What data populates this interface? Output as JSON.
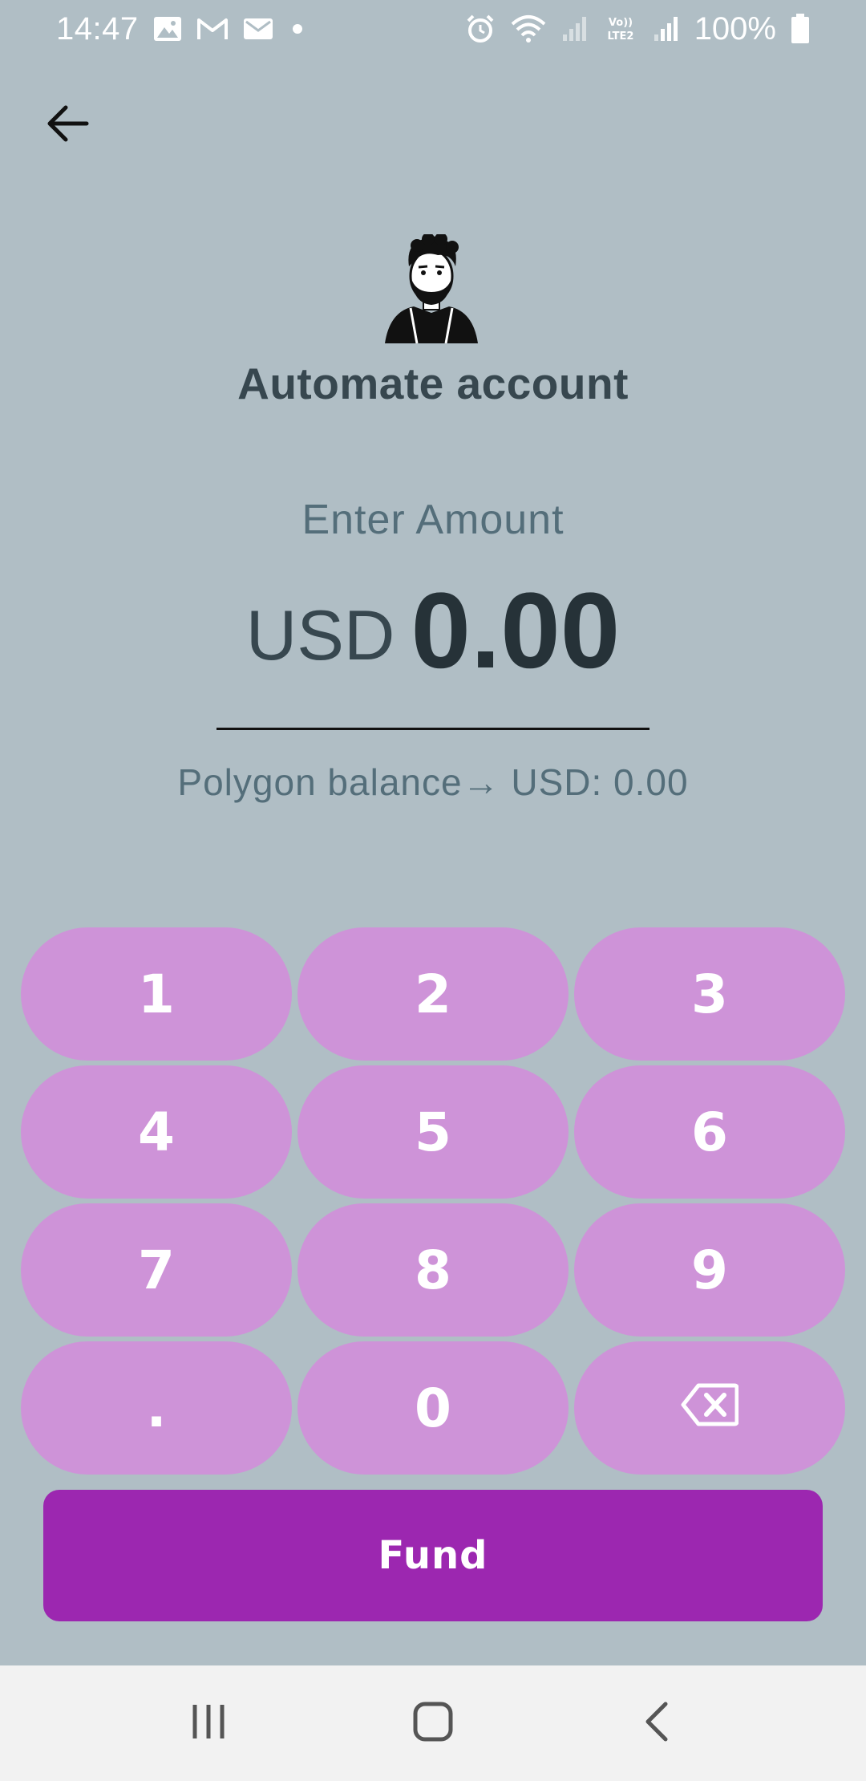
{
  "status_bar": {
    "time": "14:47",
    "battery_pct": "100%",
    "left_icons": [
      "gallery-icon",
      "gmail-icon",
      "mail-icon",
      "dot-icon"
    ],
    "right_icons": [
      "alarm-icon",
      "wifi-icon",
      "signal-icon",
      "volte-icon",
      "signal-icon",
      "battery-icon"
    ]
  },
  "header": {
    "back_icon": "arrow-left-icon"
  },
  "account": {
    "avatar_icon": "bearded-man-avatar",
    "title": "Automate account"
  },
  "amount": {
    "label": "Enter Amount",
    "currency": "USD",
    "value": "0.00"
  },
  "balance": {
    "text": "Polygon balance→ USD: 0.00"
  },
  "keypad": {
    "keys": [
      "1",
      "2",
      "3",
      "4",
      "5",
      "6",
      "7",
      "8",
      "9",
      ".",
      "0"
    ],
    "backspace_icon": "backspace-icon"
  },
  "fund_button": {
    "label": "Fund"
  },
  "colors": {
    "background": "#b0bec5",
    "key_bg": "#ce93d8",
    "fund_bg": "#9c27b0",
    "nav_bg": "#f2f2f2"
  },
  "nav_bar": {
    "icons": [
      "recent-apps-icon",
      "home-icon",
      "back-icon"
    ]
  }
}
